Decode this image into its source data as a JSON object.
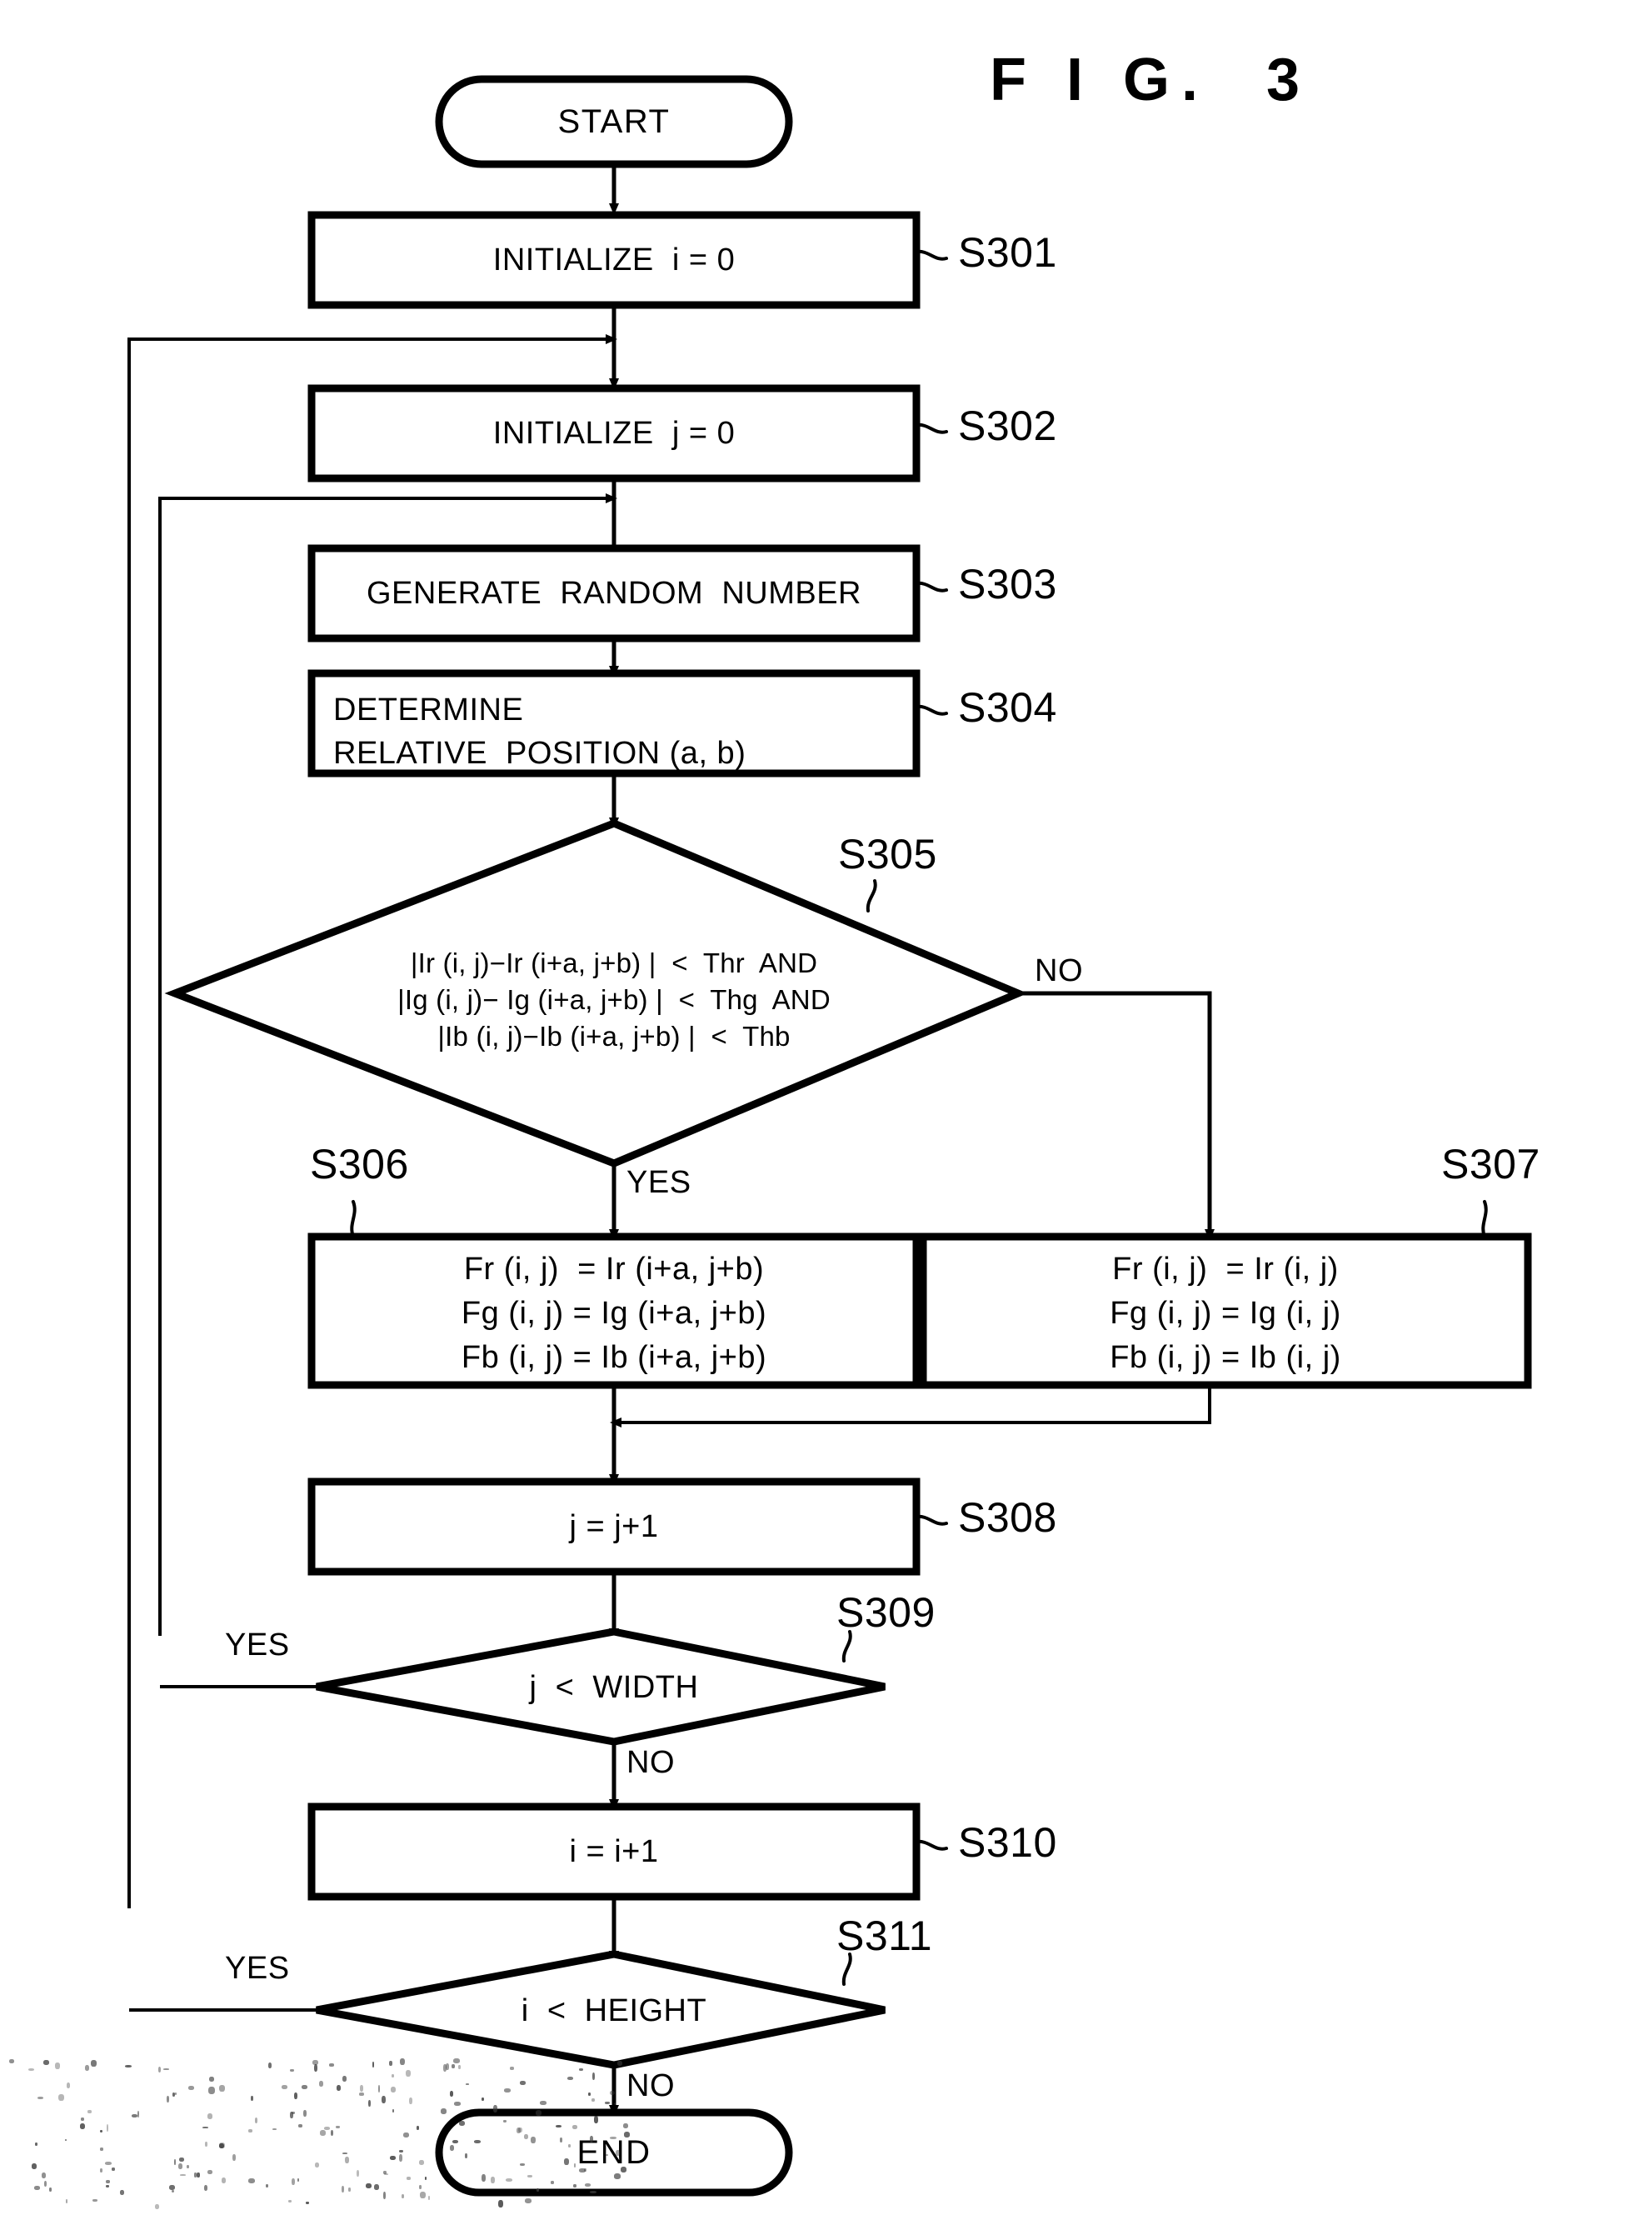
{
  "figure": {
    "title": "F I G.  3"
  },
  "nodes": {
    "start": {
      "label": "START",
      "type": "terminal"
    },
    "s301": {
      "label": "INITIALIZE  i = 0",
      "step": "S301",
      "type": "process"
    },
    "s302": {
      "label": "INITIALIZE  j = 0",
      "step": "S302",
      "type": "process"
    },
    "s303": {
      "label": "GENERATE  RANDOM  NUMBER",
      "step": "S303",
      "type": "process"
    },
    "s304": {
      "line1": "DETERMINE",
      "line2": "RELATIVE  POSITION (a, b)",
      "step": "S304",
      "type": "process"
    },
    "s305": {
      "line1": "|Ir (i, j)−Ir (i+a, j+b) |  <  Thr  AND",
      "line2": "|Ig (i, j)− Ig (i+a, j+b) |  <  Thg  AND",
      "line3": "|Ib (i, j)−Ib (i+a, j+b) |  <  Thb",
      "step": "S305",
      "type": "decision",
      "yes_label": "YES",
      "no_label": "NO"
    },
    "s306": {
      "line1": "Fr (i, j)  = Ir (i+a, j+b)",
      "line2": "Fg (i, j) = Ig (i+a, j+b)",
      "line3": "Fb (i, j) = Ib (i+a, j+b)",
      "step": "S306",
      "type": "process"
    },
    "s307": {
      "line1": "Fr (i, j)  = Ir (i, j)",
      "line2": "Fg (i, j) = Ig (i, j)",
      "line3": "Fb (i, j) = Ib (i, j)",
      "step": "S307",
      "type": "process"
    },
    "s308": {
      "label": "j = j+1",
      "step": "S308",
      "type": "process"
    },
    "s309": {
      "label": "j  <  WIDTH",
      "step": "S309",
      "type": "decision",
      "yes_label": "YES",
      "no_label": "NO"
    },
    "s310": {
      "label": "i = i+1",
      "step": "S310",
      "type": "process"
    },
    "s311": {
      "label": "i  <  HEIGHT",
      "step": "S311",
      "type": "decision",
      "yes_label": "YES",
      "no_label": "NO"
    },
    "end": {
      "label": "END",
      "type": "terminal"
    }
  },
  "colors": {
    "ink": "#000000",
    "paper": "#ffffff"
  }
}
